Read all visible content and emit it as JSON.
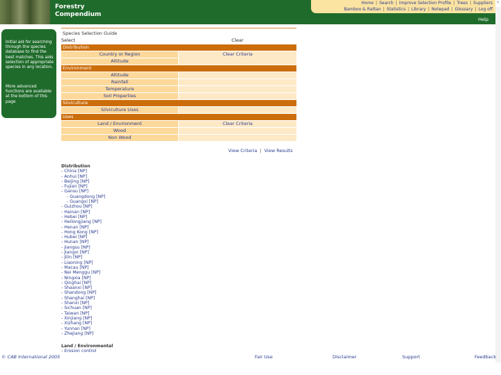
{
  "brand": {
    "line1": "Forestry",
    "line2": "Compendium"
  },
  "topnav": {
    "row1": [
      "Home",
      "Search",
      "Improve Selection Profile",
      "Trees",
      "Suppliers"
    ],
    "row2": [
      "Bamboo & Rattan",
      "Statistics",
      "Library",
      "Notepad",
      "Glossary",
      "Log off"
    ]
  },
  "help": "Help",
  "sidebar": {
    "p1": "Initial aid for searching through the species database to find the best matches. This aids selection of appropriate species in any location.",
    "p2": "More advanced functions are available at the bottom of this page"
  },
  "main": {
    "title": "Species Selection Guide",
    "select_label": "Select",
    "clear_label": "Clear",
    "sections": [
      {
        "name": "Distribution",
        "items": [
          {
            "label": "Country or Region",
            "right": "Clear Criteria",
            "tall": true
          },
          {
            "label": "Altitude",
            "right": ""
          }
        ]
      },
      {
        "name": "Environment",
        "items": [
          {
            "label": "Altitude",
            "right": ""
          },
          {
            "label": "Rainfall",
            "right": ""
          },
          {
            "label": "Temperature",
            "right": ""
          },
          {
            "label": "Soil Properties",
            "right": ""
          }
        ]
      },
      {
        "name": "Silviculture",
        "items": [
          {
            "label": "Silviculture Uses",
            "right": ""
          }
        ]
      },
      {
        "name": "Uses",
        "items": [
          {
            "label": "Land / Environment",
            "right": "Clear Criteria"
          },
          {
            "label": "Wood",
            "right": ""
          },
          {
            "label": "Non Wood",
            "right": ""
          }
        ]
      }
    ],
    "view_criteria": "View Criteria",
    "view_results": "View Results"
  },
  "distribution": {
    "heading": "Distribution",
    "items": [
      {
        "text": "- China [NP]",
        "sub": false
      },
      {
        "text": "- Anhui [NP]",
        "sub": false
      },
      {
        "text": "- Beijing [NP]",
        "sub": false
      },
      {
        "text": "- Fujian [NP]",
        "sub": false
      },
      {
        "text": "- Gansu [NP]",
        "sub": false
      },
      {
        "text": "- Guangdong [NP]",
        "sub": true
      },
      {
        "text": "- Guangxi [NP]",
        "sub": true
      },
      {
        "text": "- Guizhou [NP]",
        "sub": false
      },
      {
        "text": "- Hainan [NP]",
        "sub": false
      },
      {
        "text": "- Hebei [NP]",
        "sub": false
      },
      {
        "text": "- Heilongjiang [NP]",
        "sub": false
      },
      {
        "text": "- Henan [NP]",
        "sub": false
      },
      {
        "text": "- Hong Kong [NP]",
        "sub": false
      },
      {
        "text": "- Hubei [NP]",
        "sub": false
      },
      {
        "text": "- Hunan [NP]",
        "sub": false
      },
      {
        "text": "- Jiangsu [NP]",
        "sub": false
      },
      {
        "text": "- Jiangxi [NP]",
        "sub": false
      },
      {
        "text": "- Jilin [NP]",
        "sub": false
      },
      {
        "text": "- Liaoning [NP]",
        "sub": false
      },
      {
        "text": "- Macau [NP]",
        "sub": false
      },
      {
        "text": "- Nei Menggu [NP]",
        "sub": false
      },
      {
        "text": "- Ningxia [NP]",
        "sub": false
      },
      {
        "text": "- Qinghai [NP]",
        "sub": false
      },
      {
        "text": "- Shaanxi [NP]",
        "sub": false
      },
      {
        "text": "- Shandong [NP]",
        "sub": false
      },
      {
        "text": "- Shanghai [NP]",
        "sub": false
      },
      {
        "text": "- Shanxi [NP]",
        "sub": false
      },
      {
        "text": "- Sichuan [NP]",
        "sub": false
      },
      {
        "text": "- Taiwan [NP]",
        "sub": false
      },
      {
        "text": "- Xinjiang [NP]",
        "sub": false
      },
      {
        "text": "- Xizhang [NP]",
        "sub": false
      },
      {
        "text": "- Yunnan [NP]",
        "sub": false
      },
      {
        "text": "- Zhejiang [NP]",
        "sub": false
      }
    ]
  },
  "landenv": {
    "heading": "Land / Environmental",
    "item": "- Erosion control"
  },
  "footer": {
    "copyright": "© CAB International 2005",
    "links": [
      "Fair Use",
      "Disclaimer",
      "Support",
      "Feedback"
    ]
  }
}
